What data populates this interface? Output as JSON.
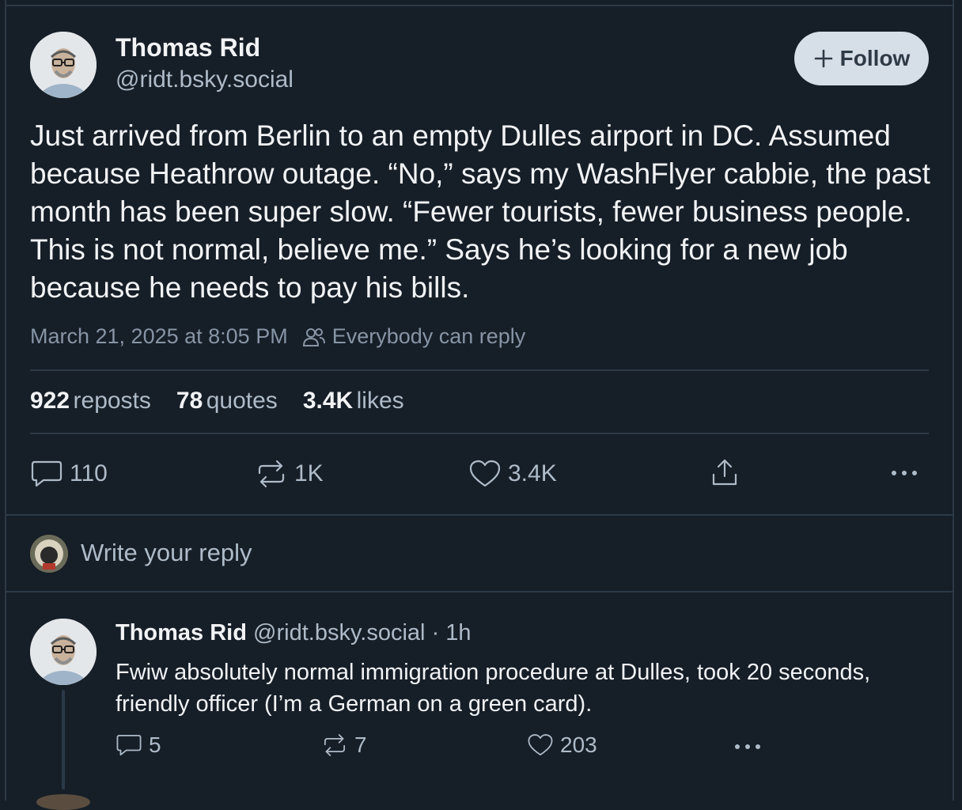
{
  "post": {
    "author_name": "Thomas Rid",
    "author_handle": "@ridt.bsky.social",
    "follow_label": "Follow",
    "text": "Just arrived from Berlin to an empty Dulles airport in DC. Assumed because Heathrow outage. “No,” says my WashFlyer cabbie, the past month has been super slow. “Fewer tourists, fewer business people. This is not normal, believe me.” Says he’s looking for a new job because he needs to pay his bills.",
    "timestamp": "March 21, 2025 at 8:05 PM",
    "reply_setting": "Everybody can reply",
    "stats": {
      "reposts_count": "922",
      "reposts_label": "reposts",
      "quotes_count": "78",
      "quotes_label": "quotes",
      "likes_count": "3.4K",
      "likes_label": "likes"
    },
    "actions": {
      "replies": "110",
      "reposts": "1K",
      "likes": "3.4K"
    }
  },
  "composer": {
    "placeholder": "Write your reply"
  },
  "reply": {
    "author_name": "Thomas Rid",
    "author_handle": "@ridt.bsky.social",
    "age": "· 1h",
    "text": "Fwiw absolutely normal immigration procedure at Dulles, took 20 seconds, friendly officer (I’m a German on a green card).",
    "actions": {
      "replies": "5",
      "reposts": "7",
      "likes": "203"
    }
  },
  "icons": {
    "follow": "plus-icon",
    "reply_setting": "people-icon",
    "reply": "speech-bubble-icon",
    "repost": "repost-arrows-icon",
    "like": "heart-icon",
    "share": "share-icon",
    "more": "ellipsis-icon"
  },
  "colors": {
    "background": "#161e27",
    "divider": "#2c3947",
    "muted_text": "#aebbc9",
    "follow_button": "#d6dfe8"
  }
}
